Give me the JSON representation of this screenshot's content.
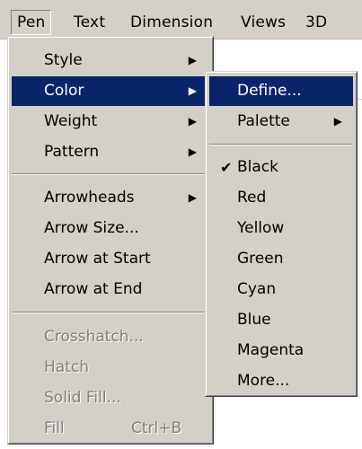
{
  "menubar": {
    "items": [
      "Pen",
      "Text",
      "Dimension",
      "Views",
      "3D"
    ]
  },
  "pen_menu": {
    "items": [
      {
        "label": "Style",
        "submenu": true
      },
      {
        "label": "Color",
        "submenu": true,
        "selected": true
      },
      {
        "label": "Weight",
        "submenu": true
      },
      {
        "label": "Pattern",
        "submenu": true
      },
      {
        "label": "Arrowheads",
        "submenu": true
      },
      {
        "label": "Arrow Size..."
      },
      {
        "label": "Arrow at Start"
      },
      {
        "label": "Arrow at End"
      },
      {
        "label": "Crosshatch...",
        "disabled": true
      },
      {
        "label": "Hatch",
        "disabled": true
      },
      {
        "label": "Solid Fill...",
        "disabled": true
      },
      {
        "label": "Fill",
        "shortcut": "Ctrl+B",
        "disabled": true
      }
    ]
  },
  "color_menu": {
    "items": [
      {
        "label": "Define...",
        "selected": true
      },
      {
        "label": "Palette",
        "submenu": true
      },
      {
        "label": "Black",
        "checked": true
      },
      {
        "label": "Red"
      },
      {
        "label": "Yellow"
      },
      {
        "label": "Green"
      },
      {
        "label": "Cyan"
      },
      {
        "label": "Blue"
      },
      {
        "label": "Magenta"
      },
      {
        "label": "More..."
      }
    ]
  },
  "colors": {
    "menu_face": "#d4d0c8",
    "highlight": "#0a246a",
    "highlight_text": "#ffffff",
    "disabled_text": "#808080"
  },
  "icons": {
    "submenu_arrow": "submenu-arrow-icon",
    "check": "checkmark-icon"
  }
}
